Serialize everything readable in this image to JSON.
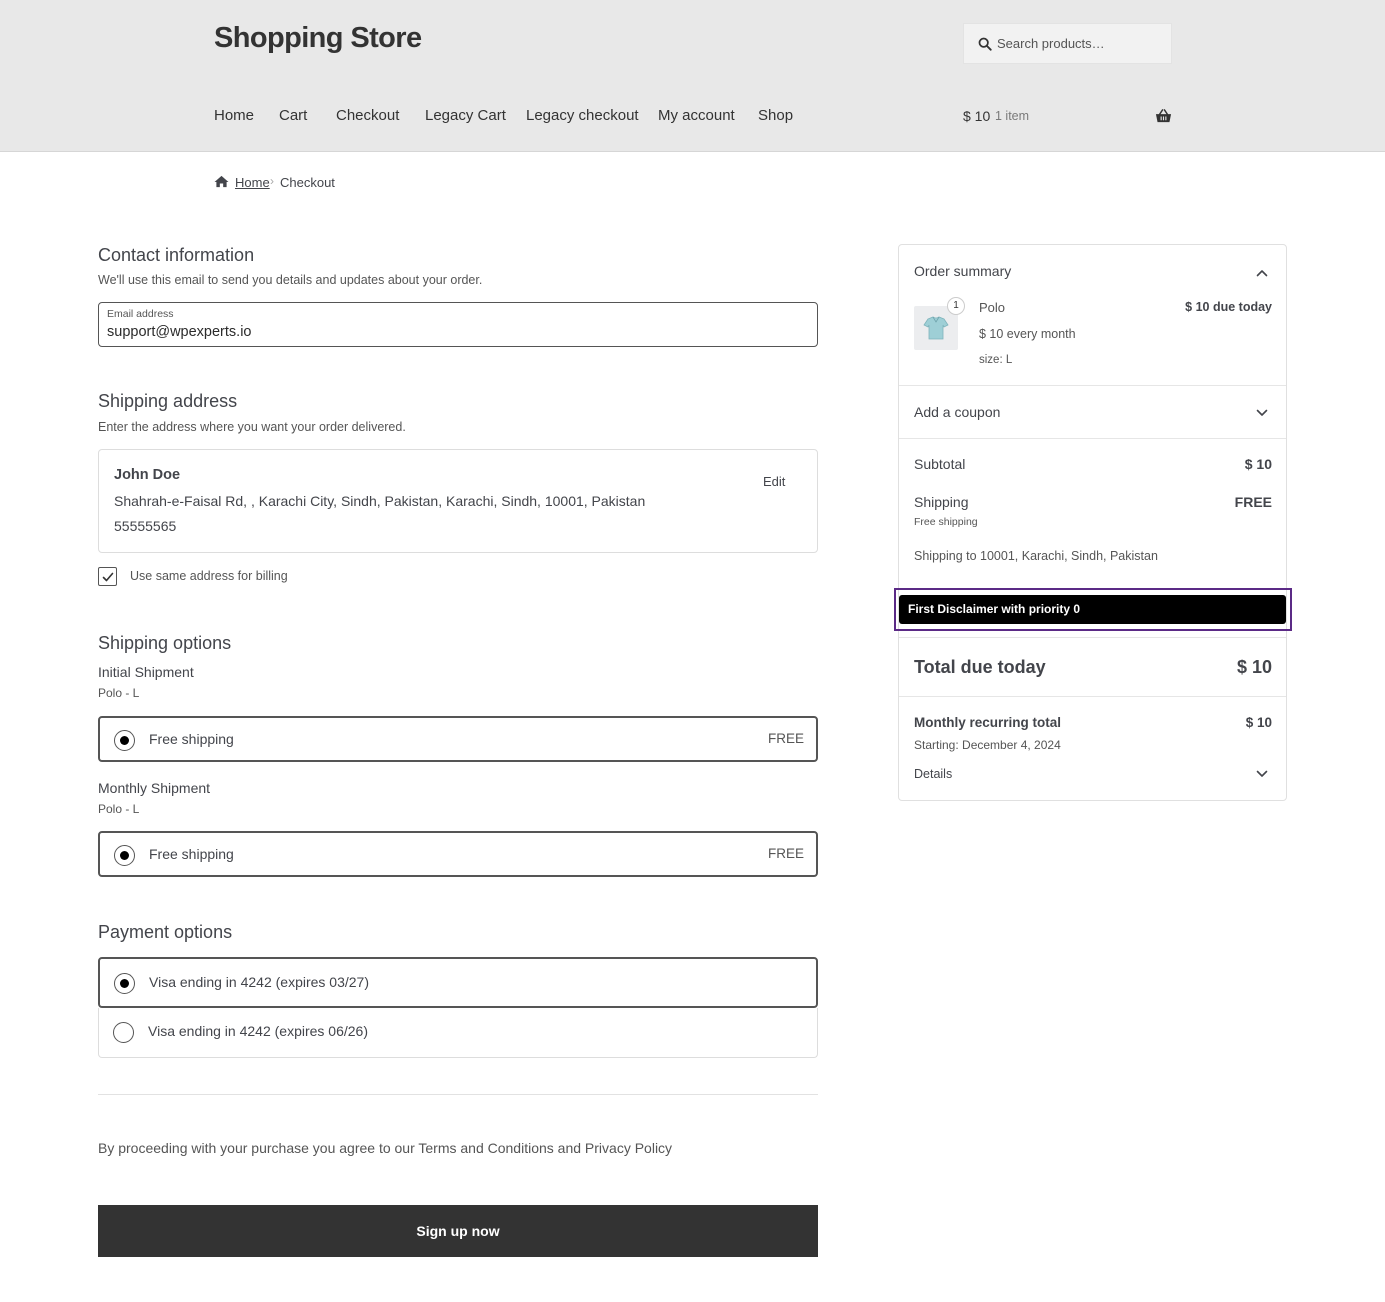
{
  "header": {
    "site_title": "Shopping Store",
    "search_placeholder": "Search products…",
    "nav": [
      "Home",
      "Cart",
      "Checkout",
      "Legacy Cart",
      "Legacy checkout",
      "My account",
      "Shop"
    ],
    "cart_amount": "$ 10",
    "cart_count": "1 item"
  },
  "breadcrumb": {
    "home": "Home",
    "separator": "›",
    "current": "Checkout"
  },
  "contact": {
    "title": "Contact information",
    "description": "We'll use this email to send you details and updates about your order.",
    "email_label": "Email address",
    "email_value": "support@wpexperts.io"
  },
  "shipping_address": {
    "title": "Shipping address",
    "description": "Enter the address where you want your order delivered.",
    "name": "John Doe",
    "address": "Shahrah-e-Faisal Rd, , Karachi City, Sindh, Pakistan, Karachi, Sindh, 10001, Pakistan",
    "phone": "55555565",
    "edit_label": "Edit",
    "billing_same_label": "Use same address for billing",
    "billing_same_checked": true
  },
  "shipping_options": {
    "title": "Shipping options",
    "groups": [
      {
        "title": "Initial Shipment",
        "subtitle": "Polo - L",
        "option_label": "Free shipping",
        "option_price": "FREE",
        "selected": true
      },
      {
        "title": "Monthly Shipment",
        "subtitle": "Polo - L",
        "option_label": "Free shipping",
        "option_price": "FREE",
        "selected": true
      }
    ]
  },
  "payment": {
    "title": "Payment options",
    "methods": [
      {
        "label": "Visa ending in 4242 (expires 03/27)",
        "selected": true
      },
      {
        "label": "Visa ending in 4242 (expires 06/26)",
        "selected": false
      }
    ]
  },
  "terms_text": "By proceeding with your purchase you agree to our Terms and Conditions and Privacy Policy",
  "signup_label": "Sign up now",
  "summary": {
    "title": "Order summary",
    "product": {
      "quantity": "1",
      "name": "Polo",
      "due": "$ 10 due today",
      "recurring": "$ 10 every month",
      "variation": "size: L"
    },
    "coupon_label": "Add a coupon",
    "subtotal_label": "Subtotal",
    "subtotal_value": "$ 10",
    "shipping_label": "Shipping",
    "shipping_value": "FREE",
    "shipping_method": "Free shipping",
    "shipping_to": "Shipping to 10001, Karachi, Sindh, Pakistan",
    "disclaimer": "First Disclaimer with priority 0",
    "total_label": "Total due today",
    "total_value": "$ 10",
    "recurring_label": "Monthly recurring total",
    "recurring_value": "$ 10",
    "recurring_start": "Starting: December 4, 2024",
    "details_label": "Details"
  },
  "colors": {
    "header_bg": "#e8e8e8",
    "button_bg": "#333333",
    "disclaimer_bg": "#000000",
    "highlight_outline": "#5b2a86",
    "text": "#43454b"
  }
}
